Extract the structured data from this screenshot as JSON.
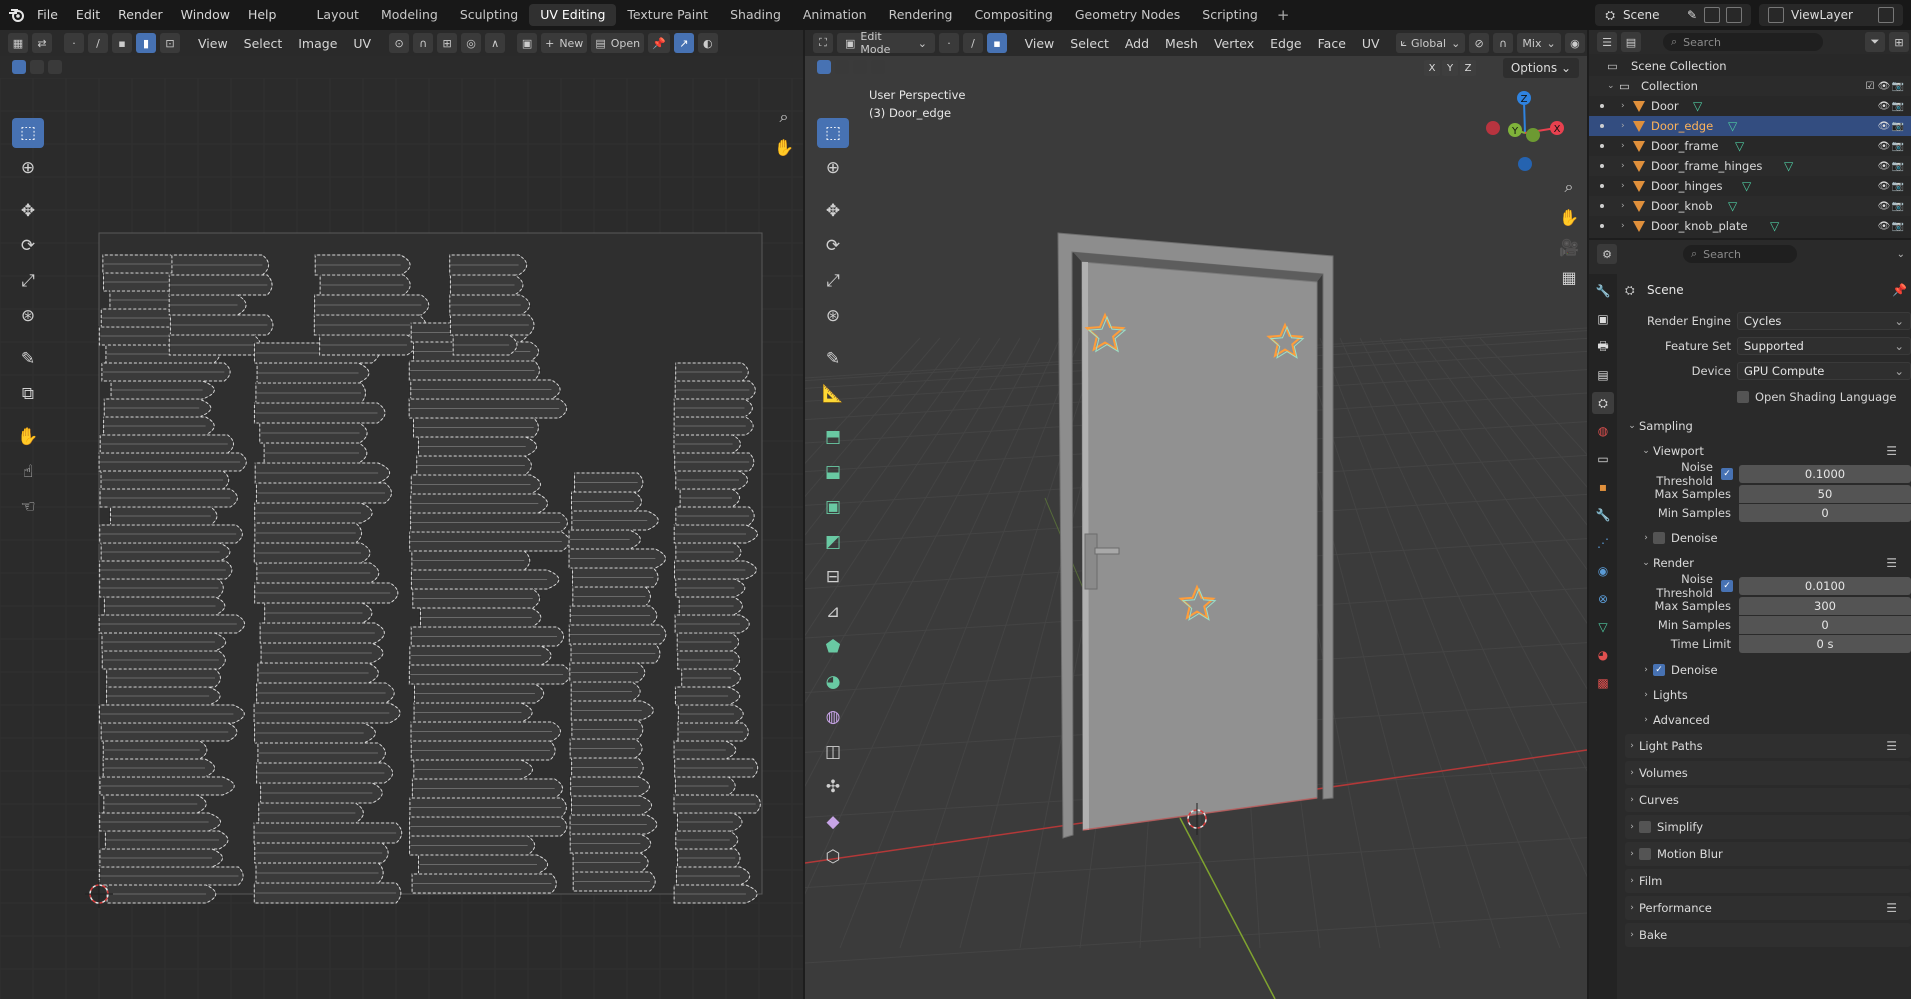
{
  "topbar": {
    "menus": [
      "File",
      "Edit",
      "Render",
      "Window",
      "Help"
    ],
    "workspaces": [
      "Layout",
      "Modeling",
      "Sculpting",
      "UV Editing",
      "Texture Paint",
      "Shading",
      "Animation",
      "Rendering",
      "Compositing",
      "Geometry Nodes",
      "Scripting"
    ],
    "active_workspace": "UV Editing",
    "scene": "Scene",
    "view_layer": "ViewLayer"
  },
  "uv_editor": {
    "menus": [
      "View",
      "Select",
      "Image",
      "UV"
    ],
    "new_label": "New",
    "open_label": "Open"
  },
  "viewport": {
    "mode": "Edit Mode",
    "menus": [
      "View",
      "Select",
      "Add",
      "Mesh",
      "Vertex",
      "Edge",
      "Face",
      "UV"
    ],
    "orientation": "Global",
    "shading": "Mix",
    "options_label": "Options",
    "xyz": [
      "X",
      "Y",
      "Z"
    ],
    "view_name": "User Perspective",
    "object_label": "(3) Door_edge",
    "gizmo": {
      "x": "X",
      "y": "Y",
      "z": "Z"
    }
  },
  "outliner": {
    "search_placeholder": "Search",
    "root": "Scene Collection",
    "collection": "Collection",
    "objects": [
      {
        "name": "Door",
        "selected": false
      },
      {
        "name": "Door_edge",
        "selected": true
      },
      {
        "name": "Door_frame",
        "selected": false
      },
      {
        "name": "Door_frame_hinges",
        "selected": false
      },
      {
        "name": "Door_hinges",
        "selected": false
      },
      {
        "name": "Door_knob",
        "selected": false
      },
      {
        "name": "Door_knob_plate",
        "selected": false
      }
    ]
  },
  "properties": {
    "search_placeholder": "Search",
    "context": "Scene",
    "render_engine": {
      "label": "Render Engine",
      "value": "Cycles"
    },
    "feature_set": {
      "label": "Feature Set",
      "value": "Supported"
    },
    "device": {
      "label": "Device",
      "value": "GPU Compute"
    },
    "osl": "Open Shading Language",
    "sampling": "Sampling",
    "viewport": {
      "title": "Viewport",
      "noise_threshold": {
        "label": "Noise Threshold",
        "value": "0.1000"
      },
      "max_samples": {
        "label": "Max Samples",
        "value": "50"
      },
      "min_samples": {
        "label": "Min Samples",
        "value": "0"
      },
      "denoise": "Denoise"
    },
    "render": {
      "title": "Render",
      "noise_threshold": {
        "label": "Noise Threshold",
        "value": "0.0100"
      },
      "max_samples": {
        "label": "Max Samples",
        "value": "300"
      },
      "min_samples": {
        "label": "Min Samples",
        "value": "0"
      },
      "time_limit": {
        "label": "Time Limit",
        "value": "0 s"
      },
      "denoise": "Denoise"
    },
    "sub_lights": "Lights",
    "sub_advanced": "Advanced",
    "panels": [
      "Light Paths",
      "Volumes",
      "Curves",
      "Simplify",
      "Motion Blur",
      "Film",
      "Performance",
      "Bake"
    ]
  },
  "colors": {
    "accent": "#4772b3",
    "selected_row": "#334d80",
    "object_icon": "#e0903c",
    "mesh_icon": "#4fc9a0",
    "x_axis": "#e8414f",
    "y_axis": "#7fb33a",
    "z_axis": "#2f83e0"
  }
}
